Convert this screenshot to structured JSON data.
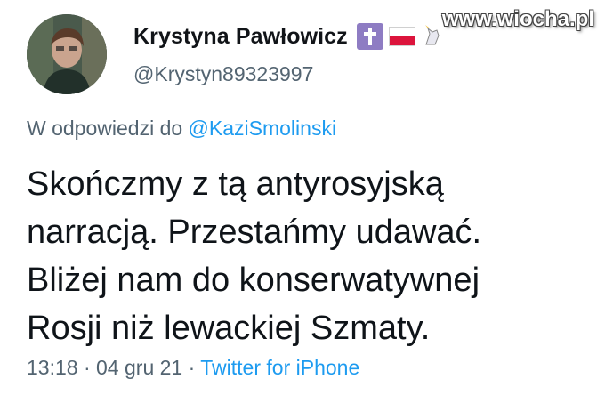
{
  "watermark": "www.wiocha.pl",
  "author": {
    "display_name": "Krystyna Pawłowicz",
    "handle": "@Krystyn89323997",
    "badges": [
      "latin-cross-icon",
      "poland-flag-icon",
      "unicorn-icon"
    ]
  },
  "reply": {
    "prefix": "W odpowiedzi do",
    "mention": "@KaziSmolinski"
  },
  "tweet": {
    "lines": [
      "Skończmy z tą antyrosyjską",
      "narracją. Przestańmy udawać.",
      "Bliżej nam do konserwatywnej",
      "Rosji niż lewackiej Szmaty."
    ]
  },
  "meta": {
    "time": "13:18",
    "separator1": "·",
    "date": "04 gru 21",
    "separator2": "·",
    "source": "Twitter for iPhone"
  },
  "colors": {
    "text": "#0f1419",
    "secondary": "#536471",
    "link": "#1d9bf0",
    "badge_purple": "#8e7cc3",
    "flag_red": "#dc143c"
  }
}
